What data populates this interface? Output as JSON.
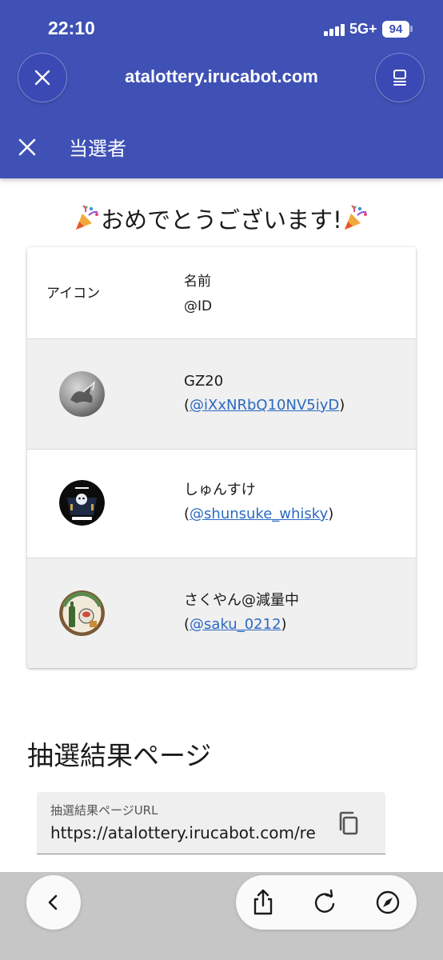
{
  "status_bar": {
    "time": "22:10",
    "network": "5G+",
    "battery": "94"
  },
  "browser": {
    "url": "atalottery.irucabot.com",
    "close_icon": "close-icon",
    "menu_icon": "reader-menu-icon"
  },
  "app_header": {
    "title": "当選者",
    "close_icon": "close-icon"
  },
  "content": {
    "congrats": "おめでとうございます!",
    "emoji_icon": "party-popper-icon"
  },
  "table": {
    "headers": {
      "icon": "アイコン",
      "name": "名前",
      "id": "@ID"
    },
    "rows": [
      {
        "name": "GZ20",
        "id": "@iXxNRbQ10NV5iyD",
        "avatar": "silver-griffin-avatar"
      },
      {
        "name": "しゅんすけ",
        "id": "@shunsuke_whisky",
        "avatar": "dark-bar-logo-avatar"
      },
      {
        "name": "さくやん@減量中",
        "id": "@saku_0212",
        "avatar": "whisky-illustration-avatar"
      }
    ],
    "paren_open": "(",
    "paren_close": ")"
  },
  "result_section": {
    "title": "抽選結果ページ",
    "field_label": "抽選結果ページURL",
    "field_value": "https://atalottery.irucabot.com/re",
    "copy_icon": "copy-icon"
  },
  "toolbar": {
    "back_icon": "chevron-left-icon",
    "share_icon": "share-icon",
    "reload_icon": "reload-icon",
    "compass_icon": "compass-icon"
  },
  "colors": {
    "brand": "#3f51b5",
    "link": "#2b69c2"
  }
}
